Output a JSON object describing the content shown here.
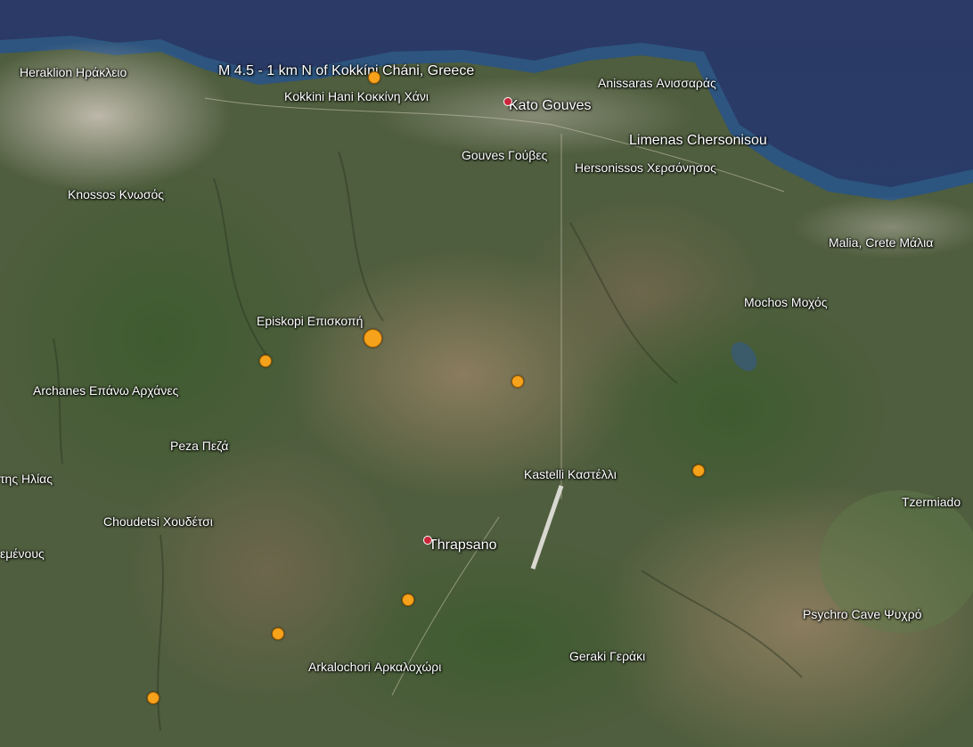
{
  "event": {
    "title": "M 4.5 - 1 km N of Kokkíni Cháni, Greece"
  },
  "colors": {
    "marker": "#f7a21b",
    "sea": "#27406e",
    "land": "#4f5e3e",
    "pin": "#c8263a"
  },
  "places": {
    "heraklion": "Heraklion Ηράκλειο",
    "kokkini_hani": "Kokkini Hani Κοκκίνη Χάνι",
    "kato_gouves": "Kato Gouves",
    "anissaras": "Anissaras Ανισσαράς",
    "gouves": "Gouves Γούβες",
    "hersonissos": "Hersonissos Χερσόνησος",
    "limenas": "Limenas Chersonisou",
    "knossos": "Knossos Κνωσός",
    "malia": "Malia, Crete Μάλια",
    "mochos": "Mochos Μοχός",
    "episkopi": "Episkopi Επισκοπή",
    "archanes": "Archanes Επάνω Αρχάνες",
    "peza": "Peza Πεζά",
    "profitis_ilias": "της Ηλίας",
    "kastelli": "Kastelli Καστέλλι",
    "tzermiado": "Tzermiado",
    "choudetsi": "Choudetsi Χουδέτσι",
    "thrapsano": "Thrapsano",
    "menous": "εμένους",
    "psychro": "Psychro Cave Ψυχρό",
    "geraki": "Geraki Γεράκι",
    "arkalochori": "Arkalochori Αρκαλοχώρι"
  },
  "earthquakes": [
    {
      "id": "q1",
      "size": "small",
      "label": "epicenter-marker"
    },
    {
      "id": "q2",
      "size": "large"
    },
    {
      "id": "q3",
      "size": "small"
    },
    {
      "id": "q4",
      "size": "small"
    },
    {
      "id": "q5",
      "size": "small"
    },
    {
      "id": "q6",
      "size": "small"
    },
    {
      "id": "q7",
      "size": "small"
    },
    {
      "id": "q8",
      "size": "small"
    }
  ]
}
